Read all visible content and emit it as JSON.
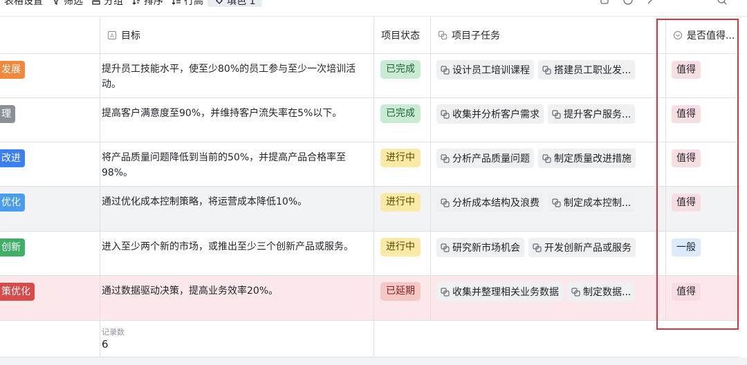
{
  "toolbar": {
    "items": [
      {
        "label": "表格设置",
        "icon": "table-settings-icon"
      },
      {
        "label": "筛选",
        "icon": "filter-icon"
      },
      {
        "label": "分组",
        "icon": "group-icon"
      },
      {
        "label": "排序",
        "icon": "sort-icon"
      },
      {
        "label": "行高",
        "icon": "row-height-icon"
      },
      {
        "label": "填色 1",
        "icon": "fill-color-icon"
      }
    ],
    "right_icons": [
      "share-icon",
      "history-icon",
      "expand-icon",
      "undo-icon",
      "redo-icon",
      "search-icon"
    ]
  },
  "columns": [
    {
      "label": "",
      "icon": ""
    },
    {
      "label": "目标",
      "icon": "text-field-icon"
    },
    {
      "label": "项目状态",
      "icon": ""
    },
    {
      "label": "项目子任务",
      "icon": "link-field-icon"
    },
    {
      "label": "",
      "icon": ""
    },
    {
      "label": "是否值得...",
      "icon": "select-field-icon"
    }
  ],
  "rows": [
    {
      "tag": "发展",
      "tag_color": "#f0883e",
      "goal": "提升员工技能水平，使至少80%的员工参与至少一次培训活动。",
      "status": "已完成",
      "status_bg": "#c9ead3",
      "status_fg": "#1f5f35",
      "subtasks": [
        "设计员工培训课程",
        "搭建员工职业发..."
      ],
      "worth": "值得",
      "worth_bg": "#f8dde3",
      "row_bg": "#ffffff"
    },
    {
      "tag": "理",
      "tag_color": "#8b8f96",
      "goal": "提高客户满意度至90%，并维持客户流失率在5%以下。",
      "status": "已完成",
      "status_bg": "#c9ead3",
      "status_fg": "#1f5f35",
      "subtasks": [
        "收集并分析客户需求",
        "提升客户服务..."
      ],
      "worth": "值得",
      "worth_bg": "#f8dde3",
      "row_bg": "#ffffff"
    },
    {
      "tag": "改进",
      "tag_color": "#3c7ff0",
      "goal": "将产品质量问题降低到当前的50%，并提高产品合格率至98%。",
      "status": "进行中",
      "status_bg": "#fbeaa7",
      "status_fg": "#5c4a00",
      "subtasks": [
        "分析产品质量问题",
        "制定质量改进措施"
      ],
      "worth": "值得",
      "worth_bg": "#f8dde3",
      "row_bg": "#ffffff"
    },
    {
      "tag": "优化",
      "tag_color": "#4a9ded",
      "goal": "通过优化成本控制策略，将运营成本降低10%。",
      "status": "进行中",
      "status_bg": "#fbeaa7",
      "status_fg": "#5c4a00",
      "subtasks": [
        "分析成本结构及浪费",
        "制定成本控制..."
      ],
      "worth": "值得",
      "worth_bg": "#f8dde3",
      "row_bg": "#f2f3f5"
    },
    {
      "tag": "创新",
      "tag_color": "#3fae66",
      "goal": "进入至少两个新的市场，或推出至少三个创新产品或服务。",
      "status": "进行中",
      "status_bg": "#fbeaa7",
      "status_fg": "#5c4a00",
      "subtasks": [
        "研究新市场机会",
        "开发创新产品或服务"
      ],
      "worth": "一般",
      "worth_bg": "#dcebfb",
      "row_bg": "#ffffff"
    },
    {
      "tag": "策优化",
      "tag_color": "#d94b4b",
      "goal": "通过数据驱动决策，提高业务效率20%。",
      "status": "已延期",
      "status_bg": "#f7c7c7",
      "status_fg": "#7a1f1f",
      "subtasks": [
        "收集并整理相关业务数据",
        "制定数据..."
      ],
      "worth": "值得",
      "worth_bg": "#f8dde3",
      "row_bg": "#fce8ea"
    }
  ],
  "footer": {
    "record_label": "记录数",
    "record_count": "6"
  },
  "colors": {
    "highlight": "#d9363e",
    "border": "#dee0e3"
  }
}
